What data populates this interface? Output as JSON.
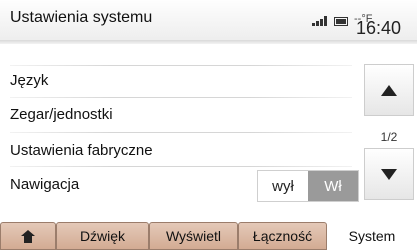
{
  "header": {
    "title": "Ustawienia systemu",
    "status_temp": "--°F",
    "clock": "16:40"
  },
  "menu": {
    "items": [
      {
        "label": "Język"
      },
      {
        "label": "Zegar/jednostki"
      },
      {
        "label": "Ustawienia fabryczne"
      },
      {
        "label": "Nawigacja"
      }
    ],
    "navigation_toggle": {
      "off_label": "wył",
      "on_label": "Wł",
      "selected": "Wł"
    }
  },
  "scroll": {
    "page_indicator": "1/2"
  },
  "tabs": [
    {
      "label": "",
      "icon": "home-icon"
    },
    {
      "label": "Dźwięk"
    },
    {
      "label": "Wyświetl"
    },
    {
      "label": "Łączność"
    },
    {
      "label": "System",
      "active": true
    }
  ],
  "icons": {
    "signal": "signal-icon",
    "battery": "battery-icon",
    "scroll_up": "triangle-up-icon",
    "scroll_down": "triangle-down-icon",
    "home": "home-icon"
  },
  "colors": {
    "tab_background": "#d9b49e",
    "toggle_active": "#9a9a9a"
  }
}
